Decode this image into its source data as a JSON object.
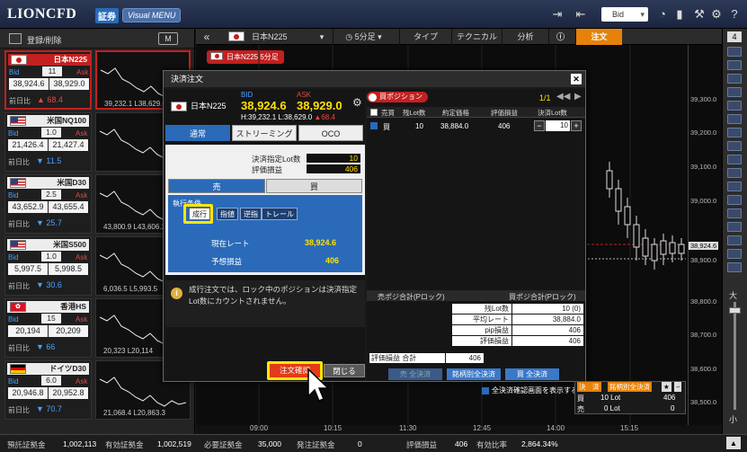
{
  "app": {
    "logo": "LIONCFD",
    "badge": "証券",
    "visual_menu": "Visual MENU",
    "bid_select": "Bid"
  },
  "left_panel": {
    "header_label": "登録/削除",
    "m_button": "M",
    "symbols": [
      {
        "name": "日本N225",
        "spread": "11",
        "bid": "38,924.6",
        "ask": "38,929.0",
        "prev_label": "前日比",
        "change": "68.4",
        "dir": "up",
        "low": "39,232.1",
        "high": "L38,629.0"
      },
      {
        "name": "米国NQ100",
        "spread": "1.0",
        "bid": "21,426.4",
        "ask": "21,427.4",
        "prev_label": "前日比",
        "change": "11.5",
        "dir": "dn",
        "low": "",
        "high": ""
      },
      {
        "name": "米国D30",
        "spread": "2.5",
        "bid": "43,652.9",
        "ask": "43,655.4",
        "prev_label": "前日比",
        "change": "25.7",
        "dir": "dn",
        "low": "43,800.9",
        "high": "L43,606.2"
      },
      {
        "name": "米国S500",
        "spread": "1.0",
        "bid": "5,997.5",
        "ask": "5,998.5",
        "prev_label": "前日比",
        "change": "30.6",
        "dir": "dn",
        "low": "6,036.5",
        "high": "L5,993.5"
      },
      {
        "name": "香港HS",
        "spread": "15",
        "bid": "20,194",
        "ask": "20,209",
        "prev_label": "前日比",
        "change": "66",
        "dir": "dn",
        "low": "20,323",
        "high": "L20,114"
      },
      {
        "name": "ドイツD30",
        "spread": "6.0",
        "bid": "20,946.8",
        "ask": "20,952.8",
        "prev_label": "前日比",
        "change": "70.7",
        "dir": "dn",
        "low": "21,068.4",
        "high": "L20,863.3"
      }
    ]
  },
  "chart": {
    "symbol": "日本N225",
    "interval": "5分足",
    "type": "タイプ",
    "technical": "テクニカル",
    "analysis": "分析",
    "order": "注文",
    "tag": "日本N225 5分足",
    "price_labels": [
      "39,300.0",
      "39,200.0",
      "39,100.0",
      "39,000.0",
      "38,924.6",
      "38,900.0",
      "38,800.0",
      "38,700.0",
      "38,600.0",
      "38,500.0"
    ],
    "time_labels": [
      "09:00",
      "10:15",
      "11:30",
      "12:45",
      "14:00",
      "15:15"
    ],
    "page_num": "4",
    "zoom_big": "大",
    "zoom_small": "小"
  },
  "dialog": {
    "title": "決済注文",
    "symbol": "日本N225",
    "bid_label": "BID",
    "ask_label": "ASK",
    "bid": "38,924.6",
    "ask": "38,929.0",
    "high": "H:39,232.1",
    "low": "L:38,629.0",
    "change": "▲68.4",
    "tabs": [
      "通常",
      "ストリーミング",
      "OCO"
    ],
    "lot_label": "決済指定Lot数",
    "lot_value": "10",
    "pnl_label": "評価損益",
    "pnl_value": "406",
    "sell": "売",
    "buy": "買",
    "exec_label": "執行条件",
    "exec_types": [
      "成行",
      "指値",
      "逆指",
      "トレール"
    ],
    "current_rate_label": "現在レート",
    "current_rate": "38,924.6",
    "expected_pnl_label": "予想損益",
    "expected_pnl": "406",
    "note": "成行注文では、ロック中のポジションは決済指定Lot数にカウントされません。",
    "confirm": "注文確認",
    "close": "閉じる"
  },
  "positions": {
    "badge": "買ポジション",
    "page": "1/1",
    "headers": [
      "売買",
      "残Lot数",
      "約定価格",
      "評価損益",
      "決済Lot数"
    ],
    "row": {
      "side": "買",
      "lots": "10",
      "price": "38,884.0",
      "pnl": "406",
      "settle": "10"
    },
    "sum_sell": "売ポジ合計(Pロック)",
    "sum_buy": "買ポジ合計(Pロック)",
    "summary": [
      {
        "k": "残Lot数",
        "v": "10 (0)"
      },
      {
        "k": "平均レート",
        "v": "38,884.0"
      },
      {
        "k": "pip損益",
        "v": "406"
      },
      {
        "k": "評価損益",
        "v": "406"
      }
    ],
    "eval_total_label": "評価損益 合計",
    "eval_total": "406",
    "btn_sell_all": "売 全決済",
    "btn_symbol_all": "銘柄別全決済",
    "btn_buy_all": "買 全決済",
    "show_confirm": "全決済確認画面を表示する"
  },
  "pos_mini": {
    "settle": "決　済",
    "symbol_all": "銘柄別全決済",
    "buy_row": "買",
    "buy_lot": "10 Lot",
    "buy_pnl": "406",
    "sell_row": "売",
    "sell_lot": "0 Lot",
    "sell_pnl": "0"
  },
  "footer": {
    "items": [
      {
        "k": "預託証拠金",
        "v": "1,002,113"
      },
      {
        "k": "有効証拠金",
        "v": "1,002,519"
      },
      {
        "k": "必要証拠金",
        "v": "35,000"
      },
      {
        "k": "発注証拠金",
        "v": "0"
      },
      {
        "k": "評価損益",
        "v": "406"
      },
      {
        "k": "有効比率",
        "v": "2,864.34%"
      }
    ]
  },
  "colors": {
    "accent": "#2a6ab8",
    "order_tab": "#e6820a",
    "confirm": "#e33a18",
    "highlight": "#ffe600"
  }
}
